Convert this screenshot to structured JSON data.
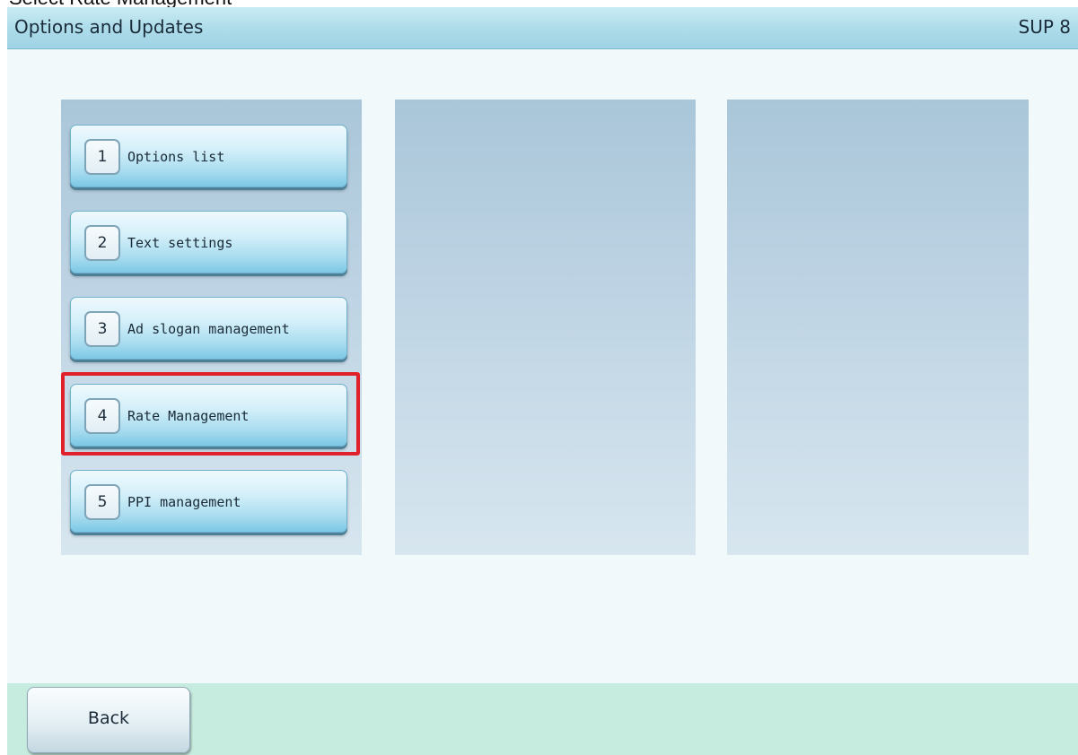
{
  "instruction": "Select Rate Management",
  "header": {
    "title": "Options and Updates",
    "screen_code": "SUP 8"
  },
  "menu": {
    "items": [
      {
        "number": "1",
        "label": "Options list"
      },
      {
        "number": "2",
        "label": "Text settings"
      },
      {
        "number": "3",
        "label": "Ad slogan management"
      },
      {
        "number": "4",
        "label": "Rate Management"
      },
      {
        "number": "5",
        "label": "PPI management"
      }
    ],
    "highlighted_item": "4"
  },
  "footer": {
    "back_label": "Back"
  },
  "colors": {
    "highlight": "#e0202a",
    "title_bar": "#aedcea",
    "footer": "#c6ebdf"
  }
}
